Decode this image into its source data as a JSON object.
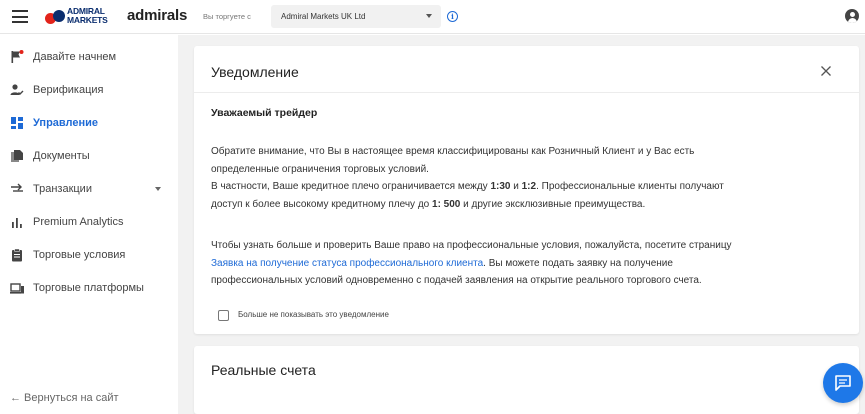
{
  "header": {
    "logo_line1": "ADMIRAL",
    "logo_line2": "MARKETS",
    "brand": "admirals",
    "trade_label": "Вы торгуете с",
    "entity_value": "Admiral Markets UK Ltd",
    "info_symbol": "i"
  },
  "sidebar": {
    "items": [
      {
        "label": "Давайте начнем",
        "icon": "flag-icon"
      },
      {
        "label": "Верификация",
        "icon": "user-check-icon"
      },
      {
        "label": "Управление",
        "icon": "dashboard-icon",
        "active": true
      },
      {
        "label": "Документы",
        "icon": "documents-icon"
      },
      {
        "label": "Транзакции",
        "icon": "transfer-icon"
      },
      {
        "label": "Premium Analytics",
        "icon": "bar-chart-icon"
      },
      {
        "label": "Торговые условия",
        "icon": "clipboard-icon"
      },
      {
        "label": "Торговые платформы",
        "icon": "laptop-icon"
      }
    ],
    "back_link": "← Вернуться на сайт"
  },
  "notice": {
    "title": "Уведомление",
    "greeting": "Уважаемый трейдер",
    "p1": "Обратите внимание, что Вы в настоящее время классифицированы как Розничный Клиент и у Вас есть",
    "p2": "определенные ограничения торговых условий.",
    "p3_a": "В частности, Ваше кредитное плечо ограничивается между ",
    "p3_b": "1:30",
    "p3_c": " и ",
    "p3_d": "1:2",
    "p3_e": ". Профессиональные клиенты получают",
    "p4_a": "доступ к более высокому кредитному плечу до ",
    "p4_b": "1: 500",
    "p4_c": " и другие эксклюзивные преимущества.",
    "p5": "Чтобы узнать больше и проверить Ваше право на профессиональные условия, пожалуйста, посетите страницу",
    "p6_link": "Заявка на получение статуса профессионального клиента",
    "p6_rest": ". Вы можете подать заявку на получение",
    "p7": "профессиональных условий одновременно с подачей заявления на открытие реального торгового счета.",
    "checkbox_label": "Больше не показывать это уведомление"
  },
  "accounts": {
    "title": "Реальные счета"
  },
  "colors": {
    "accent": "#1e6ad6",
    "fab": "#1e78e8",
    "brand_red": "#e2231a",
    "brand_navy": "#0a2d6e"
  }
}
